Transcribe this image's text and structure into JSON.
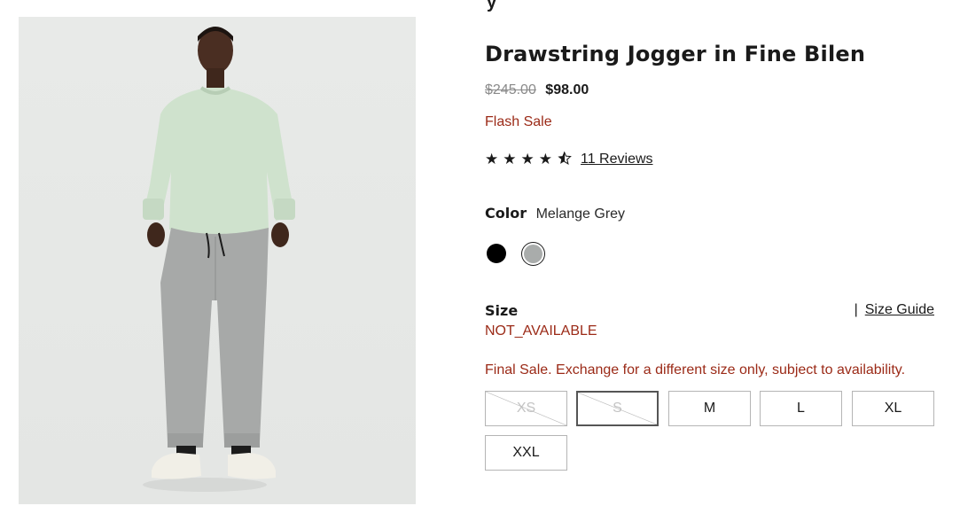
{
  "product": {
    "title": "Drawstring Jogger in Fine Bilen",
    "price_original": "$245.00",
    "price_sale": "$98.00",
    "sale_label": "Flash Sale"
  },
  "rating": {
    "value": 4.5,
    "max": 5,
    "reviews_label": "11 Reviews"
  },
  "color": {
    "label": "Color",
    "selected": "Melange Grey",
    "swatches": [
      {
        "name": "Black",
        "hex": "#000000"
      },
      {
        "name": "Melange Grey",
        "hex": "#a9acab"
      }
    ]
  },
  "size": {
    "label": "Size",
    "guide_label": "Size Guide",
    "separator": "|",
    "status": "NOT_AVAILABLE",
    "final_sale_note": "Final Sale. Exchange for a different size only, subject to availability.",
    "options": [
      "XS",
      "S",
      "M",
      "L",
      "XL",
      "XXL"
    ]
  },
  "colors": {
    "sale_red": "#9b2a17",
    "text": "#1a1a1a",
    "muted": "#8a8a8a"
  }
}
